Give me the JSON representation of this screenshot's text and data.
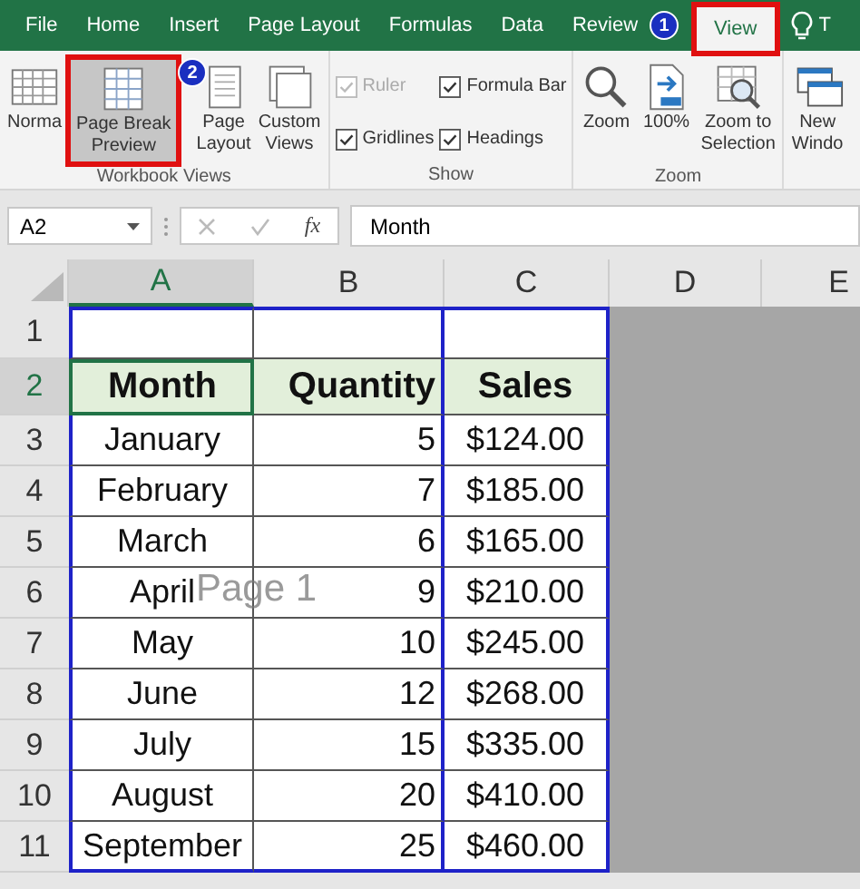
{
  "ribbon": {
    "tabs": [
      {
        "label": "File",
        "selected": false,
        "highlighted": false
      },
      {
        "label": "Home",
        "selected": false,
        "highlighted": false
      },
      {
        "label": "Insert",
        "selected": false,
        "highlighted": false
      },
      {
        "label": "Page Layout",
        "selected": false,
        "highlighted": false
      },
      {
        "label": "Formulas",
        "selected": false,
        "highlighted": false
      },
      {
        "label": "Data",
        "selected": false,
        "highlighted": false
      },
      {
        "label": "Review",
        "selected": false,
        "highlighted": false
      },
      {
        "label": "View",
        "selected": true,
        "highlighted": true
      }
    ],
    "tell_me": "T",
    "groups": [
      {
        "label": "Workbook Views",
        "kind": "buttons",
        "items": [
          {
            "label": "Norma",
            "selected": false,
            "highlighted": false
          },
          {
            "label": "Page Break\nPreview",
            "selected": true,
            "highlighted": true
          },
          {
            "label": "Page\nLayout",
            "selected": false,
            "highlighted": false
          },
          {
            "label": "Custom\nViews",
            "selected": false,
            "highlighted": false
          }
        ]
      },
      {
        "label": "Show",
        "kind": "checkboxes",
        "items": [
          {
            "label": "Ruler",
            "checked": true,
            "disabled": true
          },
          {
            "label": "Formula Bar",
            "checked": true,
            "disabled": false
          },
          {
            "label": "Gridlines",
            "checked": true,
            "disabled": false
          },
          {
            "label": "Headings",
            "checked": true,
            "disabled": false
          }
        ]
      },
      {
        "label": "Zoom",
        "kind": "buttons",
        "items": [
          {
            "label": "Zoom",
            "selected": false,
            "highlighted": false
          },
          {
            "label": "100%",
            "selected": false,
            "highlighted": false
          },
          {
            "label": "Zoom to\nSelection",
            "selected": false,
            "highlighted": false
          }
        ]
      },
      {
        "kind": "buttons",
        "items": [
          {
            "label": "New\nWindo",
            "selected": false,
            "highlighted": false
          }
        ]
      }
    ]
  },
  "markers": [
    "1",
    "2"
  ],
  "formula_bar": {
    "name_box": "A2",
    "function_label": "fx",
    "value": "Month"
  },
  "sheet": {
    "columns": [
      {
        "label": "A",
        "selected": true
      },
      {
        "label": "B",
        "selected": false
      },
      {
        "label": "C",
        "selected": false
      },
      {
        "label": "D",
        "selected": false
      },
      {
        "label": "E",
        "selected": false
      }
    ],
    "rows": [
      {
        "number": "1",
        "selected": false
      },
      {
        "number": "2",
        "selected": true,
        "kind": "header",
        "cells": [
          "Month",
          "Quantity",
          "Sales"
        ]
      },
      {
        "number": "3",
        "selected": false,
        "cells": [
          "January",
          "5",
          "$124.00"
        ]
      },
      {
        "number": "4",
        "selected": false,
        "cells": [
          "February",
          "7",
          "$185.00"
        ]
      },
      {
        "number": "5",
        "selected": false,
        "cells": [
          "March",
          "6",
          "$165.00"
        ]
      },
      {
        "number": "6",
        "selected": false,
        "cells": [
          "April",
          "9",
          "$210.00"
        ]
      },
      {
        "number": "7",
        "selected": false,
        "cells": [
          "May",
          "10",
          "$245.00"
        ]
      },
      {
        "number": "8",
        "selected": false,
        "cells": [
          "June",
          "12",
          "$268.00"
        ]
      },
      {
        "number": "9",
        "selected": false,
        "cells": [
          "July",
          "15",
          "$335.00"
        ]
      },
      {
        "number": "10",
        "selected": false,
        "cells": [
          "August",
          "20",
          "$410.00"
        ]
      },
      {
        "number": "11",
        "selected": false,
        "cells": [
          "September",
          "25",
          "$460.00"
        ]
      }
    ],
    "page_label": "Page 1"
  }
}
